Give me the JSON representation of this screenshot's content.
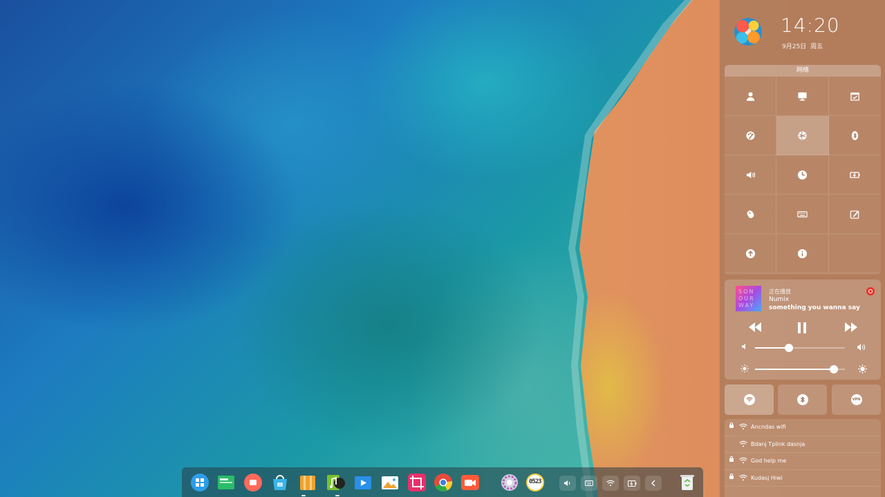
{
  "panel": {
    "clock": "14:20",
    "date": "9月25日",
    "weekday": "周五",
    "grid_title": "网络",
    "tiles": [
      {
        "icon": "account-icon"
      },
      {
        "icon": "display-icon"
      },
      {
        "icon": "calendar-icon"
      },
      {
        "icon": "personalization-icon"
      },
      {
        "icon": "network-icon",
        "active": true
      },
      {
        "icon": "bluetooth-icon"
      },
      {
        "icon": "sound-icon"
      },
      {
        "icon": "time-icon"
      },
      {
        "icon": "power-icon"
      },
      {
        "icon": "mouse-icon"
      },
      {
        "icon": "keyboard-icon"
      },
      {
        "icon": "wacom-icon"
      },
      {
        "icon": "update-icon"
      },
      {
        "icon": "info-icon"
      },
      {
        "icon": "empty"
      }
    ],
    "media": {
      "status": "正在播放",
      "artist": "Numix",
      "title": "something you wanna say",
      "volume": 0.38,
      "brightness": 0.88
    },
    "toggles": {
      "vpn_label": "VPN"
    },
    "wifi": [
      {
        "name": "Ancndas wifi",
        "locked": true
      },
      {
        "name": "Bdanj Tplink dasnja",
        "locked": false
      },
      {
        "name": "God help me",
        "locked": true
      },
      {
        "name": "Kudasj  Hiwi",
        "locked": true
      }
    ]
  },
  "dock": {
    "apps": [
      {
        "name": "launcher",
        "color": "#2f9de8"
      },
      {
        "name": "file-manager",
        "color": "#2dbb6a"
      },
      {
        "name": "screen-recorder",
        "color": "#ff6a5a"
      },
      {
        "name": "app-store",
        "color": "#3ab4e8"
      },
      {
        "name": "archive-manager",
        "color": "#f0a030"
      },
      {
        "name": "music",
        "color": "#7ac030"
      },
      {
        "name": "movie",
        "color": "#2a90e8"
      },
      {
        "name": "image-viewer",
        "color": "#f0b060"
      },
      {
        "name": "screenshot",
        "color": "#e8306a"
      },
      {
        "name": "chrome",
        "color": "#e84a3a"
      },
      {
        "name": "camera",
        "color": "#ff5a3a"
      },
      {
        "name": "settings",
        "color": "#c05ac8"
      },
      {
        "name": "clock",
        "color": "#ffd040"
      }
    ],
    "clock_widget": "0523"
  }
}
